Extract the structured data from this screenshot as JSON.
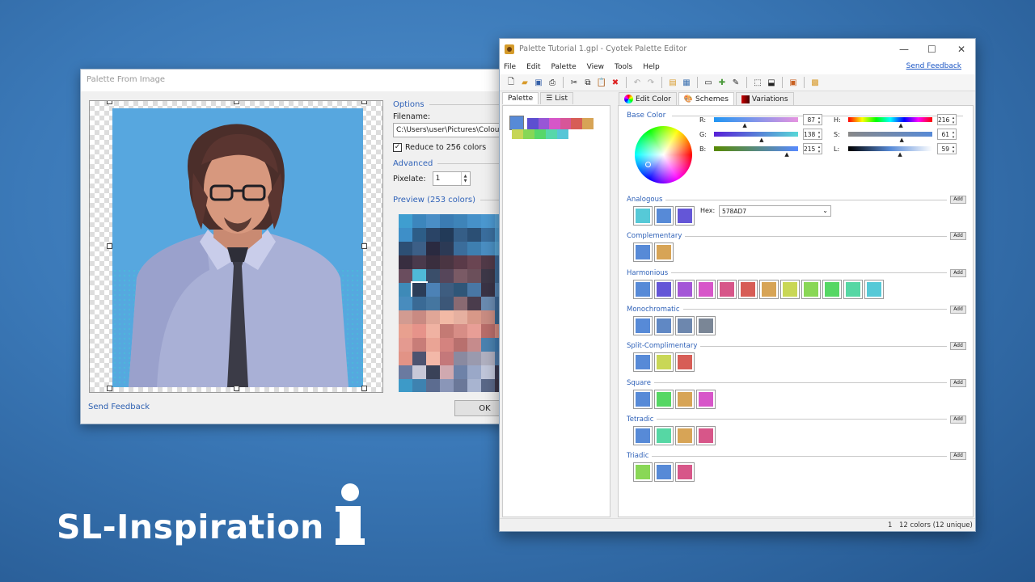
{
  "pfi": {
    "title": "Palette From Image",
    "options_label": "Options",
    "filename_label": "Filename:",
    "filename_value": "C:\\Users\\user\\Pictures\\Colour",
    "reduce_label": "Reduce to 256 colors",
    "reduce_checked": true,
    "advanced_label": "Advanced",
    "pixelate_label": "Pixelate:",
    "pixelate_value": "1",
    "preview_label": "Preview (253 colors)",
    "send_feedback": "Send Feedback",
    "ok": "OK",
    "pixel_colors": [
      "#3f9ed0",
      "#3c86bd",
      "#4a8ec6",
      "#3b7cb3",
      "#3e84b9",
      "#4691c9",
      "#4b98d0",
      "#5aa5d8",
      "#3e8fc8",
      "#2d5d87",
      "#2a4466",
      "#223a58",
      "#355e87",
      "#2b4f74",
      "#3a6e9e",
      "#4e9bcf",
      "#2d4f74",
      "#3c5f87",
      "#2a2a40",
      "#2c3a55",
      "#3b6d9b",
      "#3e7fb0",
      "#4a8ec2",
      "#5aa7d7",
      "#382e40",
      "#4a3a4c",
      "#3a2e3e",
      "#4a3542",
      "#5a3a48",
      "#6a4552",
      "#513a48",
      "#3d6896",
      "#6a4d5e",
      "#4fbad7",
      "#3a4e6a",
      "#56465a",
      "#7a5a65",
      "#6b4f5a",
      "#3d3848",
      "#3d6993",
      "#3e8ab8",
      "#2b3d58",
      "#4c82b6",
      "#3e5d80",
      "#2f5678",
      "#4977a4",
      "#3a3345",
      "#5686b3",
      "#488cbe",
      "#3a6a95",
      "#4576a0",
      "#3c5778",
      "#8a6a72",
      "#4a3c4c",
      "#6a8bb0",
      "#3e6a98",
      "#d29b91",
      "#c98a82",
      "#e0a697",
      "#f2b9a5",
      "#e6b0a0",
      "#d89888",
      "#c98c82",
      "#3a6892",
      "#e8a08f",
      "#e6938a",
      "#f0b2a2",
      "#c47a74",
      "#d78d86",
      "#e89e96",
      "#b86d6a",
      "#d88f84",
      "#e49a90",
      "#c87d78",
      "#eaa495",
      "#d4837f",
      "#b8706e",
      "#c68b8c",
      "#4a82b0",
      "#3e7ab0",
      "#e29386",
      "#4d5370",
      "#f3b8a8",
      "#c4787a",
      "#8a8aa0",
      "#9a9aae",
      "#b0b0c0",
      "#4e7aa8",
      "#6a7aa0",
      "#c8c8d8",
      "#3a4258",
      "#d0a9b0",
      "#6e82a8",
      "#9aa8c8",
      "#c0c6da",
      "#3a3a52",
      "#3d9ac8",
      "#3e82b0",
      "#5c6c90",
      "#8a96b8",
      "#6b7899",
      "#a8b4d0",
      "#5a6888",
      "#3b3648",
      "#9ab4d8",
      "#a8b8d8",
      "#8aa0c8",
      "#c0c8e0",
      "#a4b0d0",
      "#8a9ac0",
      "#7a8ab0",
      "#4a3a3a"
    ]
  },
  "cpe": {
    "title": "Palette Tutorial 1.gpl - Cyotek Palette Editor",
    "menu": [
      "File",
      "Edit",
      "Palette",
      "View",
      "Tools",
      "Help"
    ],
    "send_feedback": "Send Feedback",
    "left_tabs": [
      "Palette",
      "List"
    ],
    "right_tabs": [
      "Edit Color",
      "Schemes",
      "Variations"
    ],
    "palette_swatches": [
      "#578AD7",
      "#5d4fd0",
      "#9856d6",
      "#d656c8",
      "#d75698",
      "#d75d56",
      "#d7a456",
      "#c6d656",
      "#86d756",
      "#56d76a",
      "#56d7aa",
      "#56c6d7"
    ],
    "base_color_label": "Base Color",
    "rgb": [
      {
        "label": "R:",
        "value": "87",
        "from": "#2196f3",
        "to": "#e694e0",
        "pos": 0.34
      },
      {
        "label": "G:",
        "value": "138",
        "from": "#5720d7",
        "to": "#57d7d7",
        "pos": 0.54
      },
      {
        "label": "B:",
        "value": "215",
        "from": "#578a00",
        "to": "#578aff",
        "pos": 0.84
      }
    ],
    "hsl": [
      {
        "label": "H:",
        "value": "216",
        "pos": 0.6
      },
      {
        "label": "S:",
        "value": "61",
        "pos": 0.61
      },
      {
        "label": "L:",
        "value": "59",
        "pos": 0.59
      }
    ],
    "hex_label": "Hex:",
    "hex_value": "578AD7",
    "schemes": [
      {
        "name": "Analogous",
        "colors": [
          "#56c9d7",
          "#578ad7",
          "#6456d7"
        ]
      },
      {
        "name": "Complementary",
        "colors": [
          "#578ad7",
          "#d7a456"
        ]
      },
      {
        "name": "Harmonious",
        "colors": [
          "#578ad7",
          "#6456d7",
          "#a456d7",
          "#d756c9",
          "#d75689",
          "#d75d56",
          "#d7a456",
          "#c9d756",
          "#89d756",
          "#56d764",
          "#56d7a4",
          "#56c9d7"
        ]
      },
      {
        "name": "Monochromatic",
        "colors": [
          "#578ad7",
          "#6088c4",
          "#6d87ae",
          "#7a8696"
        ]
      },
      {
        "name": "Split-Complimentary",
        "colors": [
          "#578ad7",
          "#c9d756",
          "#d75d56"
        ]
      },
      {
        "name": "Square",
        "colors": [
          "#578ad7",
          "#56d764",
          "#d7a456",
          "#d756c9"
        ]
      },
      {
        "name": "Tetradic",
        "colors": [
          "#578ad7",
          "#56d7a4",
          "#d7a456",
          "#d75689"
        ]
      },
      {
        "name": "Triadic",
        "colors": [
          "#89d756",
          "#578ad7",
          "#d75689"
        ]
      }
    ],
    "add_label": "Add",
    "status_index": "1",
    "status_colors": "12 colors (12 unique)"
  },
  "brand": {
    "text": "SL-Inspiration"
  }
}
